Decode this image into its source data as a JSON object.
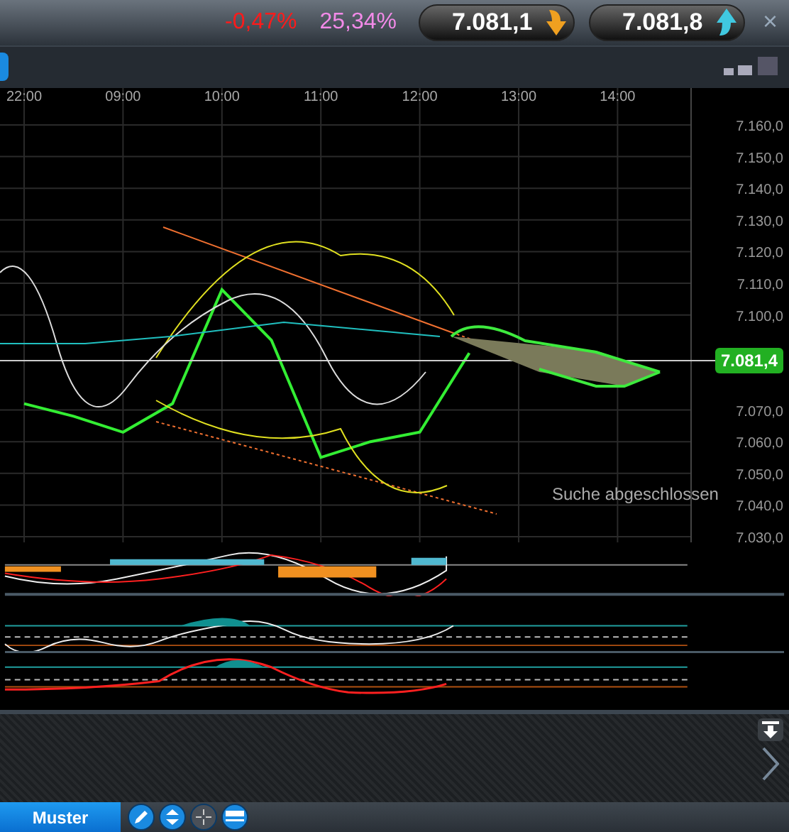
{
  "header": {
    "change": "-0,47%",
    "change_2": "25,34%",
    "quotes": [
      {
        "price": "7.081,1",
        "kind": "down"
      },
      {
        "price": "7.081,8",
        "kind": "up"
      }
    ],
    "close": "×"
  },
  "chart": {
    "chart_data": {
      "type": "line",
      "categories": [
        "22:00",
        null,
        "09:00",
        null,
        "10:00",
        null,
        "11:00",
        null,
        "12:00",
        null,
        "13:00",
        null,
        "14:00"
      ],
      "values": [
        7072,
        7068,
        7063,
        7072,
        7108,
        7092,
        7055,
        7060,
        7063,
        7088,
        null,
        null,
        null
      ],
      "yticks": [
        {
          "value": 7160,
          "label": "7.160,0"
        },
        {
          "value": 7150,
          "label": "7.150,0"
        },
        {
          "value": 7140,
          "label": "7.140,0"
        },
        {
          "value": 7130,
          "label": "7.130,0"
        },
        {
          "value": 7120,
          "label": "7.120,0"
        },
        {
          "value": 7110,
          "label": "7.110,0"
        },
        {
          "value": 7100,
          "label": "7.100,0"
        },
        {
          "value": 7070,
          "label": "7.070,0"
        },
        {
          "value": 7060,
          "label": "7.060,0"
        },
        {
          "value": 7050,
          "label": "7.050,0"
        },
        {
          "value": 7040,
          "label": "7.040,0"
        },
        {
          "value": 7030,
          "label": "7.030,0"
        }
      ],
      "ylim": [
        7030,
        7160
      ],
      "grid": true
    },
    "last_price": "7.081,4",
    "status": "Suche abgeschlossen"
  },
  "footer": {
    "tab": "Muster"
  }
}
